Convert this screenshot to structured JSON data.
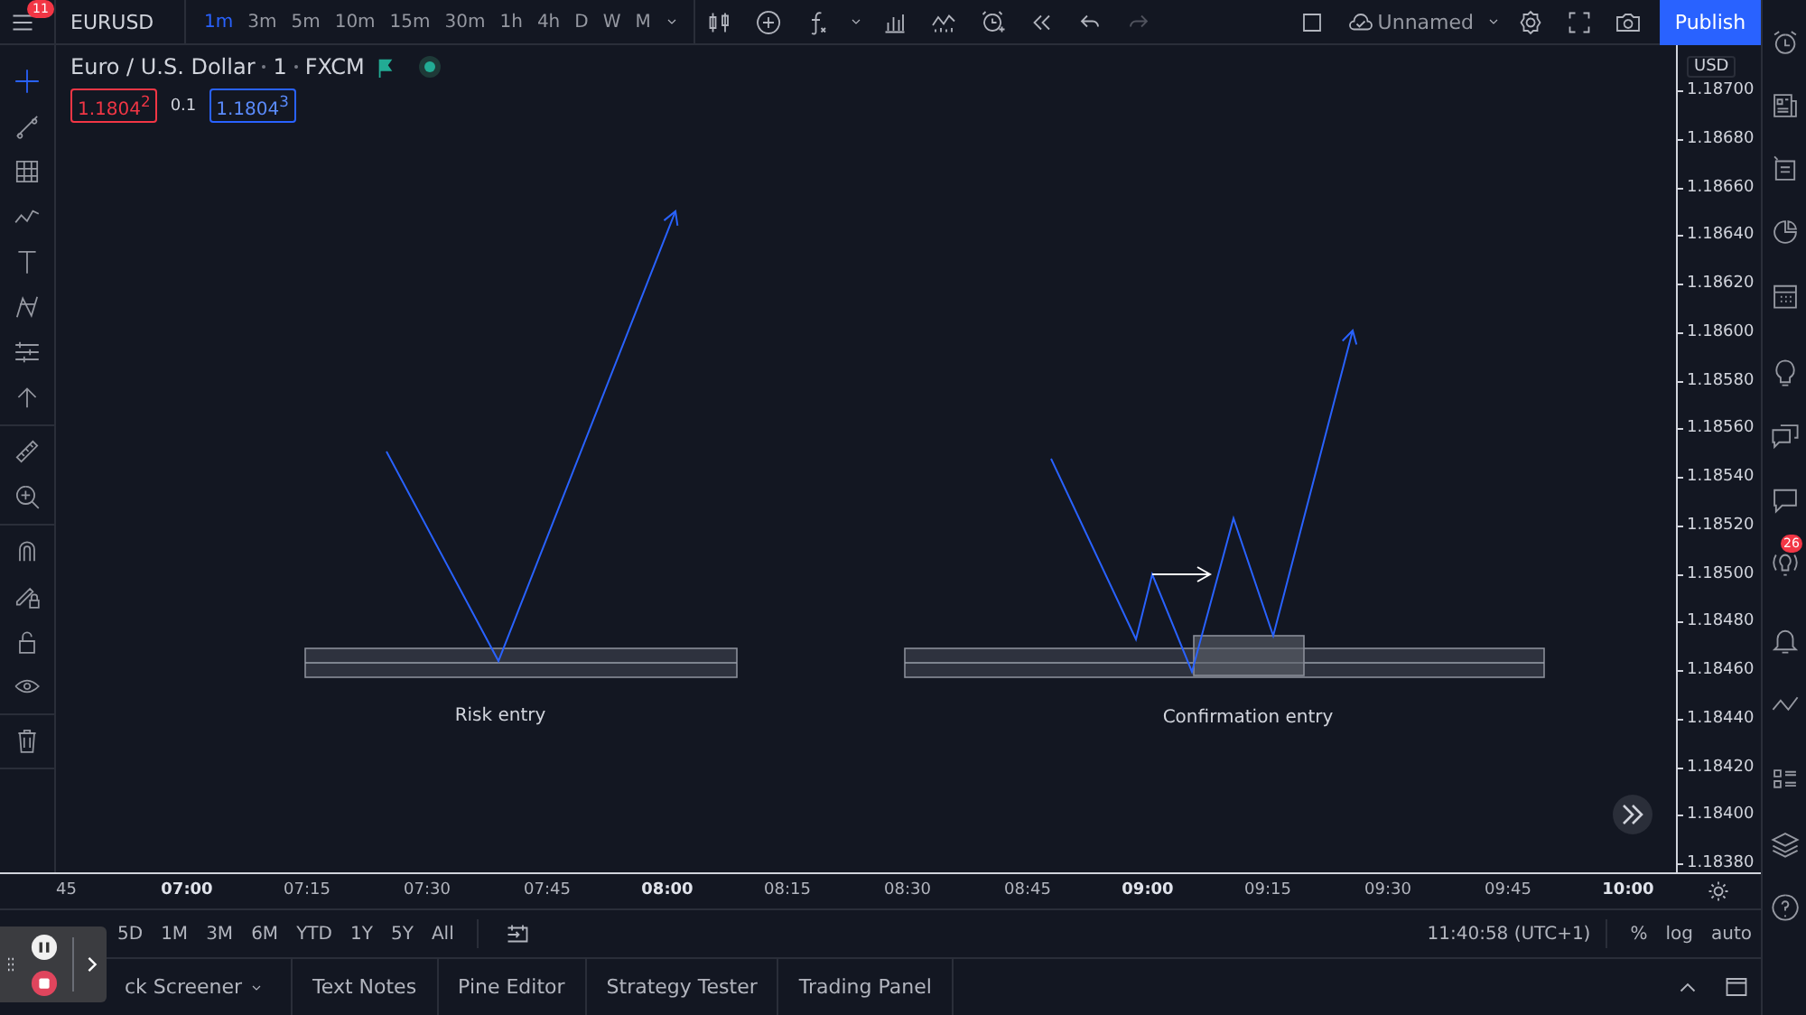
{
  "top_bar": {
    "menu_badge": "11",
    "symbol": "EURUSD",
    "intervals": [
      {
        "label": "1m",
        "selected": true
      },
      {
        "label": "3m",
        "selected": false
      },
      {
        "label": "5m",
        "selected": false
      },
      {
        "label": "10m",
        "selected": false
      },
      {
        "label": "15m",
        "selected": false
      },
      {
        "label": "30m",
        "selected": false
      },
      {
        "label": "1h",
        "selected": false
      },
      {
        "label": "4h",
        "selected": false
      },
      {
        "label": "D",
        "selected": false
      },
      {
        "label": "W",
        "selected": false
      },
      {
        "label": "M",
        "selected": false
      }
    ],
    "layout_name": "Unnamed",
    "publish": "Publish"
  },
  "legend": {
    "title": "Euro / U.S. Dollar",
    "interval": "1",
    "source": "FXCM",
    "sell": "1.1804$^{2}$",
    "spread": "0.1",
    "buy": "1.1804$^{3}$"
  },
  "drawings": [
    {
      "label": "Risk entry"
    },
    {
      "label": "Confirmation entry"
    }
  ],
  "price_axis": {
    "currency": "USD",
    "labels": [
      "1.18700",
      "1.18680",
      "1.18660",
      "1.18640",
      "1.18620",
      "1.18600",
      "1.18580",
      "1.18560",
      "1.18540",
      "1.18520",
      "1.18500",
      "1.18480",
      "1.18460",
      "1.18440",
      "1.18420",
      "1.18400",
      "1.18380"
    ]
  },
  "time_axis": [
    {
      "label": "45",
      "major": false
    },
    {
      "label": "07:00",
      "major": true
    },
    {
      "label": "07:15",
      "major": false
    },
    {
      "label": "07:30",
      "major": false
    },
    {
      "label": "07:45",
      "major": false
    },
    {
      "label": "08:00",
      "major": true
    },
    {
      "label": "08:15",
      "major": false
    },
    {
      "label": "08:30",
      "major": false
    },
    {
      "label": "08:45",
      "major": false
    },
    {
      "label": "09:00",
      "major": true
    },
    {
      "label": "09:15",
      "major": false
    },
    {
      "label": "09:30",
      "major": false
    },
    {
      "label": "09:45",
      "major": false
    },
    {
      "label": "10:00",
      "major": true
    }
  ],
  "range_bar": {
    "ranges": [
      "5D",
      "1M",
      "3M",
      "6M",
      "YTD",
      "1Y",
      "5Y",
      "All"
    ],
    "clock": "11:40:58 (UTC+1)",
    "options": [
      "%",
      "log",
      "auto"
    ]
  },
  "bottom_tabs": [
    "ck Screener",
    "Text Notes",
    "Pine Editor",
    "Strategy Tester",
    "Trading Panel"
  ],
  "right_sidebar": {
    "badge": "26"
  }
}
